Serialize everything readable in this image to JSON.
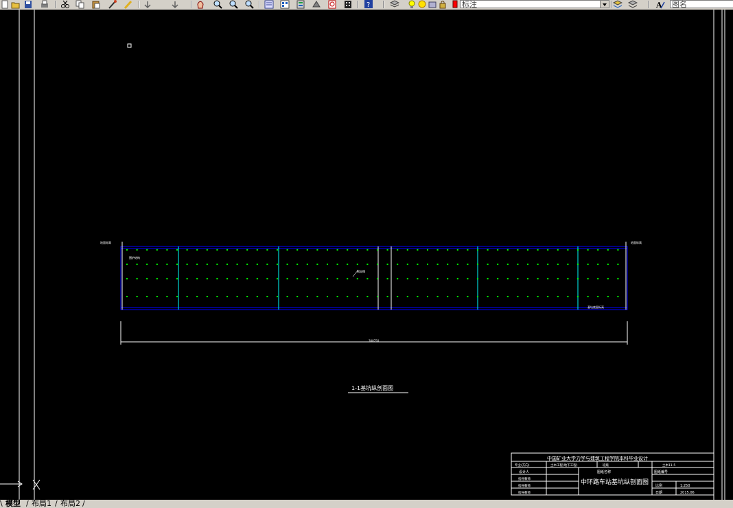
{
  "toolbar": {
    "icons": [
      "new-icon",
      "open-icon",
      "save-icon",
      "print-icon",
      "cut-icon",
      "copy-icon",
      "paste-icon",
      "match-properties-icon",
      "brush-icon",
      "undo-icon",
      "redo-icon",
      "pan-icon",
      "zoom-realtime-icon",
      "zoom-window-icon",
      "zoom-previous-icon",
      "properties-icon",
      "design-center-icon",
      "tool-palette-icon",
      "markup-icon",
      "calculator-icon",
      "help-icon",
      "layer-manager-icon",
      "layer-state-icon"
    ],
    "layer_combo_value": "标注",
    "text_style_value": "图名"
  },
  "colors": {
    "background": "#000000",
    "blue": "#0000ff",
    "green": "#00ff00",
    "white": "#ffffff",
    "cyan": "#00ffff"
  },
  "drawing": {
    "section_title": "1-1基坑纵剖面图",
    "overall_dimension": "300750",
    "left_label": "围护结构",
    "mid_label": "钢支撑",
    "bottom_right_label": "基坑底面标高",
    "left_elev": "地面标高",
    "right_elev": "地面标高"
  },
  "title_block": {
    "university": "中国矿业大学力学与建筑工程学院本科毕业设计",
    "row1": [
      "专业(方向)",
      "土木工程(地下工程)",
      "班级",
      "土木11-5"
    ],
    "designer_label": "设计人",
    "drawing_name_label": "图纸名称",
    "drawing_no_label": "图纸编号",
    "advisor1": "指导教师",
    "advisor2": "指导教师",
    "advisor3": "指导教师",
    "drawing_name": "中环路车站基坑纵剖面图",
    "scale_label": "比例",
    "scale_value": "1:250",
    "date_label": "日期",
    "date_value": "2015.06"
  },
  "layout_tabs": [
    "模型",
    "布局1",
    "布局2"
  ]
}
